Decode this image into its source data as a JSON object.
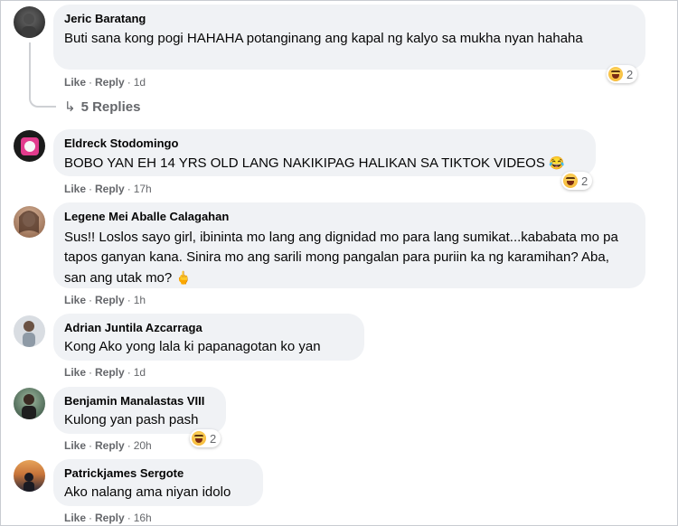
{
  "comments": [
    {
      "author": "Jeric Baratang",
      "text": "Buti sana kong pogi HAHAHA potanginang ang kapal ng kalyo sa mukha nyan hahaha",
      "like": "Like",
      "reply": "Reply",
      "time": "1d",
      "reaction_count": "2",
      "reaction_icon": "haha-reaction-icon",
      "replies_label": "5 Replies"
    },
    {
      "author": "Eldreck Stodomingo",
      "text": "BOBO YAN EH 14 YRS OLD LANG NAKIKIPAG HALIKAN SA TIKTOK VIDEOS",
      "emoji": "😂",
      "like": "Like",
      "reply": "Reply",
      "time": "17h",
      "reaction_count": "2",
      "reaction_icon": "haha-reaction-icon"
    },
    {
      "author": "Legene Mei Aballe Calagahan",
      "text": "Sus!! Loslos sayo girl, ibininta mo lang ang dignidad mo para lang sumikat...kababata mo pa tapos ganyan kana. Sinira mo ang sarili mong pangalan para puriin ka ng karamihan? Aba, san ang utak mo?",
      "emoji": "🖕",
      "like": "Like",
      "reply": "Reply",
      "time": "1h"
    },
    {
      "author": "Adrian Juntila Azcarraga",
      "text": "Kong Ako yong lala ki papanagotan ko yan",
      "like": "Like",
      "reply": "Reply",
      "time": "1d"
    },
    {
      "author": "Benjamin Manalastas VIII",
      "text": "Kulong yan pash pash",
      "like": "Like",
      "reply": "Reply",
      "time": "20h",
      "reaction_count": "2",
      "reaction_icon": "haha-reaction-icon"
    },
    {
      "author": "Patrickjames Sergote",
      "text": "Ako nalang ama niyan idolo",
      "like": "Like",
      "reply": "Reply",
      "time": "16h"
    }
  ],
  "colors": {
    "bubble": "#f0f2f5",
    "meta": "#65676b",
    "text": "#050505"
  }
}
